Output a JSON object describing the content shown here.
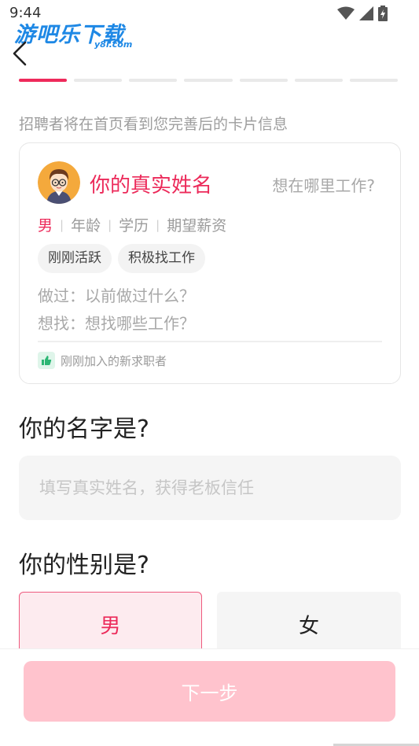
{
  "status_bar": {
    "time": "9:44"
  },
  "watermark": {
    "main": "游吧乐下载",
    "sub": "y8l.com"
  },
  "progress": {
    "total_steps": 7,
    "current_step": 1
  },
  "hint": "招聘者将在首页看到您完善后的卡片信息",
  "card": {
    "name": "你的真实姓名",
    "where": "想在哪里工作?",
    "gender": "男",
    "age": "年龄",
    "education": "学历",
    "salary": "期望薪资",
    "chips": [
      "刚刚活跃",
      "积极找工作"
    ],
    "did": "做过：以前做过什么？",
    "want": "想找：想找哪些工作？",
    "footer": "刚刚加入的新求职者"
  },
  "name_question": {
    "title": "你的名字是?",
    "placeholder": "填写真实姓名，获得老板信任",
    "value": ""
  },
  "gender_question": {
    "title": "你的性别是?",
    "male": "男",
    "female": "女",
    "selected": "男"
  },
  "next_button": "下一步",
  "colors": {
    "accent": "#ec2a5a",
    "button_disabled": "#ffc3cd",
    "input_bg": "#f5f5f5"
  }
}
